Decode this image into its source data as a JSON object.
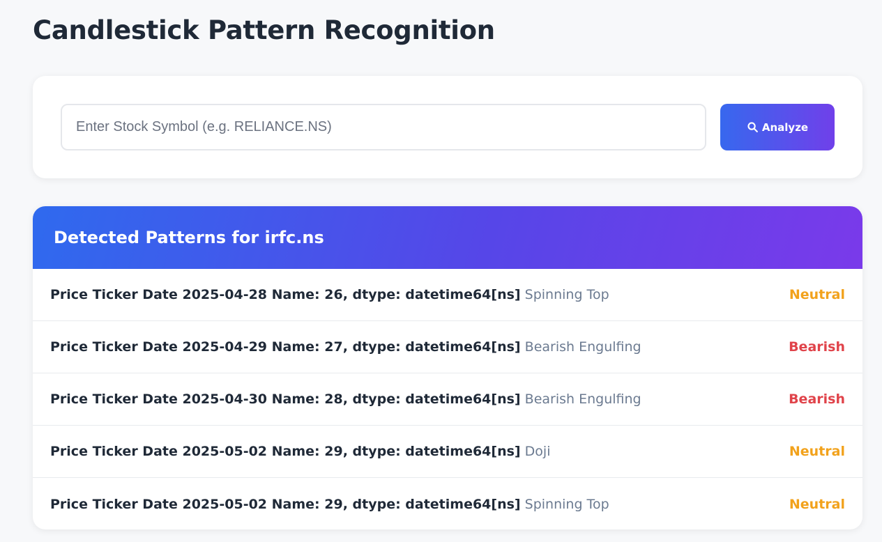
{
  "page": {
    "title": "Candlestick Pattern Recognition"
  },
  "search": {
    "placeholder": "Enter Stock Symbol (e.g. RELIANCE.NS)",
    "value": "",
    "button_label": "Analyze",
    "button_icon": "search-icon"
  },
  "results": {
    "title": "Detected Patterns for irfc.ns",
    "rows": [
      {
        "date_text": "Price Ticker Date 2025-04-28 Name: 26, dtype: datetime64[ns]",
        "pattern": "Spinning Top",
        "sentiment": "Neutral"
      },
      {
        "date_text": "Price Ticker Date 2025-04-29 Name: 27, dtype: datetime64[ns]",
        "pattern": "Bearish Engulfing",
        "sentiment": "Bearish"
      },
      {
        "date_text": "Price Ticker Date 2025-04-30 Name: 28, dtype: datetime64[ns]",
        "pattern": "Bearish Engulfing",
        "sentiment": "Bearish"
      },
      {
        "date_text": "Price Ticker Date 2025-05-02 Name: 29, dtype: datetime64[ns]",
        "pattern": "Doji",
        "sentiment": "Neutral"
      },
      {
        "date_text": "Price Ticker Date 2025-05-02 Name: 29, dtype: datetime64[ns]",
        "pattern": "Spinning Top",
        "sentiment": "Neutral"
      }
    ]
  },
  "colors": {
    "accent_start": "#3768ee",
    "accent_end": "#7040ea",
    "neutral": "#f2a21c",
    "bearish": "#e0434a"
  }
}
